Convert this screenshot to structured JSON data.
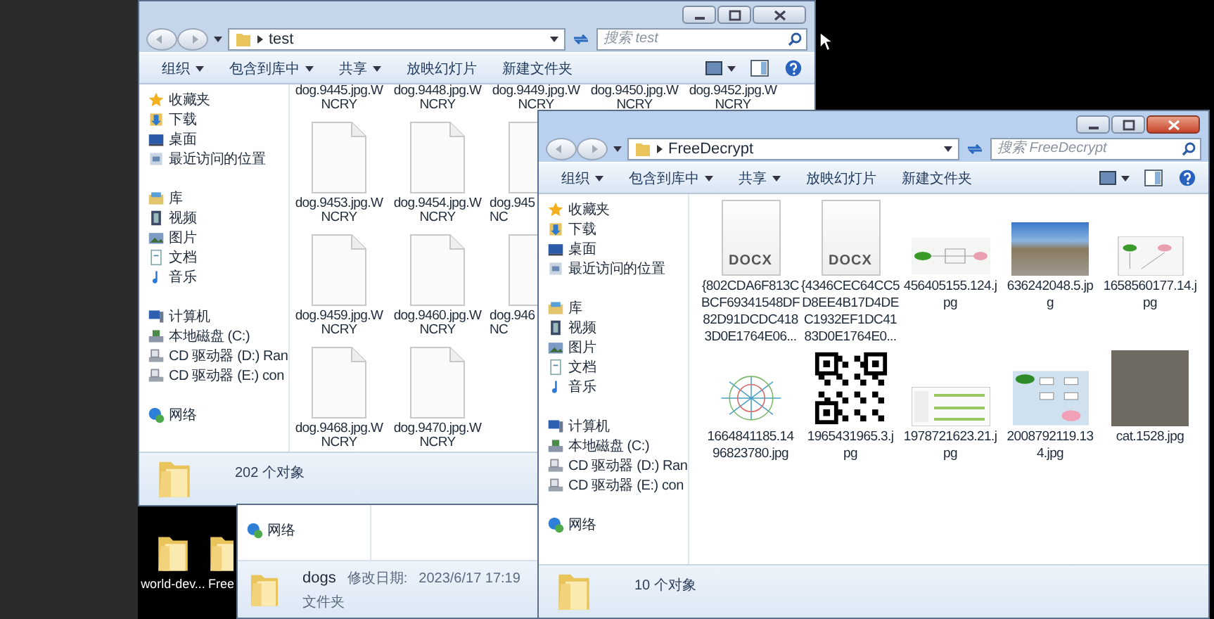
{
  "desktop": {
    "icons": [
      {
        "label": "world-dev..."
      },
      {
        "label": "Free"
      }
    ]
  },
  "windows": [
    {
      "kind": "explorer",
      "active": false,
      "address": "test",
      "search_placeholder": "搜索 test",
      "status": "202 个对象",
      "toolbar": [
        {
          "label": "组织",
          "dropdown": true
        },
        {
          "label": "包含到库中",
          "dropdown": true
        },
        {
          "label": "共享",
          "dropdown": true
        },
        {
          "label": "放映幻灯片",
          "dropdown": false
        },
        {
          "label": "新建文件夹",
          "dropdown": false
        }
      ],
      "nav": [
        {
          "label": "收藏夹",
          "kind": "star",
          "children": [
            {
              "label": "下载",
              "kind": "download"
            },
            {
              "label": "桌面",
              "kind": "desktop"
            },
            {
              "label": "最近访问的位置",
              "kind": "recent"
            }
          ]
        },
        {
          "label": "库",
          "kind": "library",
          "children": [
            {
              "label": "视频",
              "kind": "video"
            },
            {
              "label": "图片",
              "kind": "picture"
            },
            {
              "label": "文档",
              "kind": "document"
            },
            {
              "label": "音乐",
              "kind": "music"
            }
          ]
        },
        {
          "label": "计算机",
          "kind": "computer",
          "children": [
            {
              "label": "本地磁盘 (C:)",
              "kind": "disk"
            },
            {
              "label": "CD 驱动器 (D:) Ran",
              "kind": "cd"
            },
            {
              "label": "CD 驱动器 (E:) con",
              "kind": "cd"
            }
          ]
        },
        {
          "label": "网络",
          "kind": "network"
        }
      ],
      "file_rows": [
        [
          {
            "kind": "cut_top",
            "name_lines": [
              "dog.9445.jpg.W",
              "NCRY"
            ]
          },
          {
            "kind": "cut_top",
            "name_lines": [
              "dog.9448.jpg.W",
              "NCRY"
            ]
          },
          {
            "kind": "cut_top",
            "name_lines": [
              "dog.9449.jpg.W",
              "NCRY"
            ]
          },
          {
            "kind": "cut_top",
            "name_lines": [
              "dog.9450.jpg.W",
              "NCRY"
            ]
          },
          {
            "kind": "cut_top",
            "name_lines": [
              "dog.9452.jpg.W",
              "NCRY"
            ]
          }
        ],
        [
          {
            "kind": "blank",
            "name_lines": [
              "dog.9453.jpg.W",
              "NCRY"
            ]
          },
          {
            "kind": "blank",
            "name_lines": [
              "dog.9454.jpg.W",
              "NCRY"
            ]
          },
          {
            "kind": "cut_right",
            "name_lines": [
              "dog.945",
              "NC"
            ]
          }
        ],
        [
          {
            "kind": "blank",
            "name_lines": [
              "dog.9459.jpg.W",
              "NCRY"
            ]
          },
          {
            "kind": "blank",
            "name_lines": [
              "dog.9460.jpg.W",
              "NCRY"
            ]
          },
          {
            "kind": "cut_right",
            "name_lines": [
              "dog.946",
              "NC"
            ]
          }
        ],
        [
          {
            "kind": "blank",
            "name_lines": [
              "dog.9468.jpg.W",
              "NCRY"
            ]
          },
          {
            "kind": "blank",
            "name_lines": [
              "dog.9470.jpg.W",
              "NCRY"
            ]
          }
        ]
      ]
    },
    {
      "kind": "explorer",
      "active": true,
      "address": "FreeDecrypt",
      "search_placeholder": "搜索 FreeDecrypt",
      "status": "10 个对象",
      "toolbar": [
        {
          "label": "组织",
          "dropdown": true
        },
        {
          "label": "包含到库中",
          "dropdown": true
        },
        {
          "label": "共享",
          "dropdown": true
        },
        {
          "label": "放映幻灯片",
          "dropdown": false
        },
        {
          "label": "新建文件夹",
          "dropdown": false
        }
      ],
      "nav": [
        {
          "label": "收藏夹",
          "kind": "star",
          "children": [
            {
              "label": "下载",
              "kind": "download"
            },
            {
              "label": "桌面",
              "kind": "desktop"
            },
            {
              "label": "最近访问的位置",
              "kind": "recent"
            }
          ]
        },
        {
          "label": "库",
          "kind": "library",
          "children": [
            {
              "label": "视频",
              "kind": "video"
            },
            {
              "label": "图片",
              "kind": "picture"
            },
            {
              "label": "文档",
              "kind": "document"
            },
            {
              "label": "音乐",
              "kind": "music"
            }
          ]
        },
        {
          "label": "计算机",
          "kind": "computer",
          "children": [
            {
              "label": "本地磁盘 (C:)",
              "kind": "disk"
            },
            {
              "label": "CD 驱动器 (D:) Ran",
              "kind": "cd"
            },
            {
              "label": "CD 驱动器 (E:) con",
              "kind": "cd"
            }
          ]
        },
        {
          "label": "网络",
          "kind": "network"
        }
      ],
      "file_rows": [
        [
          {
            "kind": "docx",
            "badge": "DOCX",
            "name_lines": [
              "{802CDA6F813C",
              "BCF69341548DF",
              "82D91DCDC418",
              "3D0E1764E06..."
            ]
          },
          {
            "kind": "docx",
            "badge": "DOCX",
            "name_lines": [
              "{4346CEC64CC5",
              "D8EE4B17D4DE",
              "C1932EF1DC41",
              "83D0E1764E0..."
            ]
          },
          {
            "kind": "diagram",
            "name_lines": [
              "456405155.124.j",
              "pg"
            ]
          },
          {
            "kind": "photo",
            "name_lines": [
              "636242048.5.jp",
              "g"
            ]
          },
          {
            "kind": "screenshot",
            "name_lines": [
              "1658560177.14.j",
              "pg"
            ]
          }
        ],
        [
          {
            "kind": "map",
            "name_lines": [
              "1664841185.14",
              "96823780.jpg"
            ]
          },
          {
            "kind": "qr",
            "name_lines": [
              "1965431965.3.j",
              "pg"
            ]
          },
          {
            "kind": "table",
            "name_lines": [
              "1978721623.21.j",
              "pg"
            ]
          },
          {
            "kind": "flowchart",
            "name_lines": [
              "2008792119.13",
              "4.jpg"
            ]
          },
          {
            "kind": "photo_tall",
            "name_lines": [
              "cat.1528.jpg"
            ]
          }
        ]
      ]
    },
    {
      "kind": "details",
      "nav": [
        {
          "label": "网络",
          "kind": "network"
        }
      ],
      "details": {
        "name": "dogs",
        "date_label": "修改日期:",
        "date": "2023/6/17 17:19",
        "type": "文件夹"
      }
    }
  ]
}
